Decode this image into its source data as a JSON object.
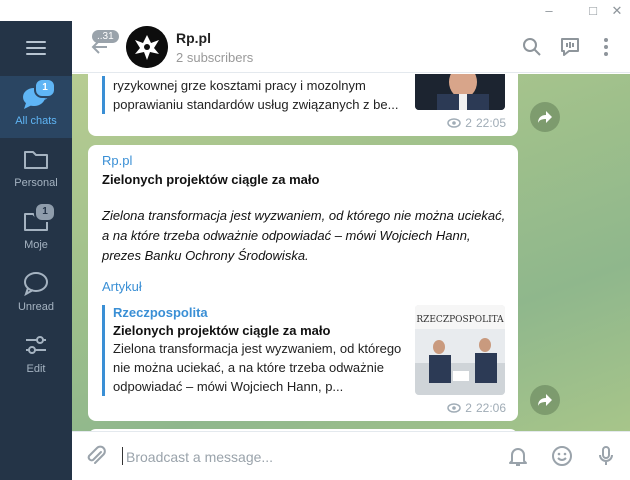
{
  "window": {
    "minimize": "–",
    "maximize": "□",
    "close": "✕"
  },
  "sidebar": {
    "menu_icon": "hamburger-icon",
    "folders": [
      {
        "label": "All chats",
        "badge": "1",
        "icon": "chat-bubbles-icon",
        "active": true
      },
      {
        "label": "Personal",
        "badge": "",
        "icon": "folder-icon",
        "active": false
      },
      {
        "label": "Moje",
        "badge": "1",
        "icon": "folder-icon",
        "active": false
      },
      {
        "label": "Unread",
        "badge": "",
        "icon": "chat-bubble-icon",
        "active": false
      },
      {
        "label": "Edit",
        "badge": "",
        "icon": "sliders-icon",
        "active": false
      }
    ]
  },
  "header": {
    "unread_count": "..31",
    "title": "Rp.pl",
    "subtitle": "2 subscribers"
  },
  "messages": [
    {
      "preview_text": "ryzykownej grze kosztami pracy i mozolnym poprawianiu standardów usług związanych z be...",
      "views": "2",
      "time": "22:05"
    },
    {
      "channel": "Rp.pl",
      "title": "Zielonych projektów ciągle za mało",
      "body": "Zielona transformacja jest wyzwaniem, od którego nie można uciekać, a na które trzeba odważnie odpowiadać – mówi Wojciech Hann, prezes Banku Ochrony Środowiska.",
      "link": "Artykuł",
      "preview": {
        "site": "Rzeczpospolita",
        "title": "Zielonych projektów ciągle za mało",
        "text": "Zielona transformacja jest wyzwaniem, od którego nie można uciekać, a na które trzeba odważnie odpowiadać – mówi Wojciech Hann, p...",
        "thumb_logo": "RZECZPOSPOLITA"
      },
      "views": "2",
      "time": "22:06"
    }
  ],
  "composer": {
    "placeholder": "Broadcast a message..."
  },
  "colors": {
    "sidebar": "#243447",
    "accent": "#3a8fd5",
    "active_folder": "#5fb5f5"
  }
}
